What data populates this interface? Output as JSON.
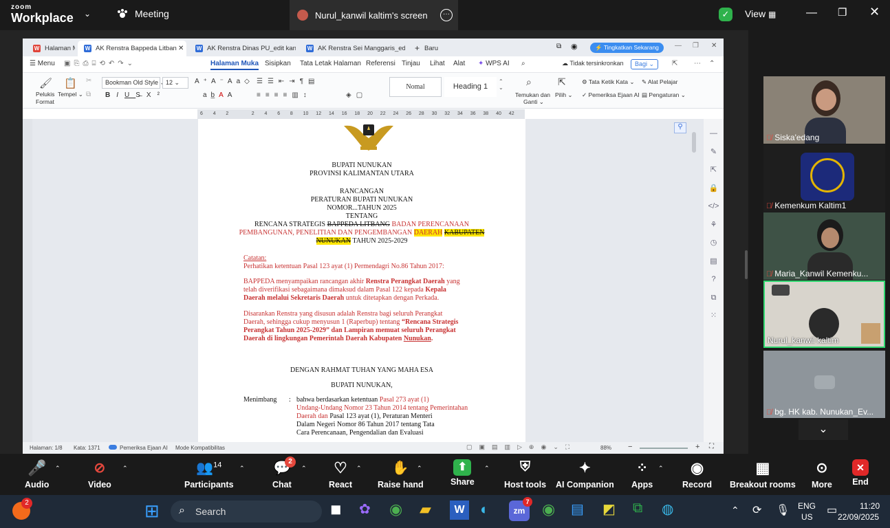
{
  "zoom": {
    "logo_top": "zoom",
    "logo_bottom": "Workplace",
    "meeting_label": "Meeting",
    "share_title": "Nurul_kanwil kaltim's screen",
    "view_label": "View"
  },
  "wps": {
    "tabs": [
      "Halaman Mu",
      "AK Renstra Bappeda Litban",
      "AK Renstra Dinas PU_edit kanwil.doc",
      "AK Renstra Sei Manggaris_edit kanwi",
      "Baru"
    ],
    "upgrade": "Tingkatkan Sekarang",
    "menu": [
      "Menu",
      "Halaman Muka",
      "Sisipkan",
      "Tata Letak Halaman",
      "Referensi",
      "Tinjau",
      "Lihat",
      "Alat",
      "WPS AI"
    ],
    "sync": "Tidak tersinkronkan",
    "share": "Bagi",
    "font": "Bookman Old Style",
    "size": "12",
    "style_normal": "Nomal",
    "style_heading": "Heading 1",
    "ribbon_labels": {
      "pelukis": "Pelukis",
      "format": "Format",
      "tempel": "Tempel",
      "temukan": "Temukan dan",
      "ganti": "Ganti",
      "pilih": "Pilih",
      "tata_ketik": "Tata Ketik Kata",
      "alat_pelajar": "Alat Pelajar",
      "pemeriksa": "Pemeriksa Ejaan AI",
      "pengaturan": "Pengaturan"
    },
    "ruler": [
      "6",
      "4",
      "2",
      "",
      "2",
      "4",
      "6",
      "8",
      "10",
      "12",
      "14",
      "16",
      "18",
      "20",
      "22",
      "24",
      "26",
      "28",
      "30",
      "32",
      "34",
      "36",
      "38",
      "40",
      "42"
    ],
    "status": {
      "page": "Halaman: 1/8",
      "words": "Kata: 1371",
      "spell": "Pemeriksa Ejaan AI",
      "mode": "Mode Kompatibilitas",
      "zoom": "88%"
    }
  },
  "doc": {
    "l1": "BUPATI NUNUKAN",
    "l2": "PROVINSI KALIMANTAN UTARA",
    "l3": "RANCANGAN",
    "l4": "PERATURAN BUPATI NUNUKAN",
    "l5": "NOMOR...TAHUN 2025",
    "l6": "TENTANG",
    "t1a": "RENCANA STRATEGIS ",
    "t1b": "BAPPEDA LITBANG",
    "t1c": " BADAN PERENCANAAN",
    "t2a": "PEMBANGUNAN, PENELITIAN DAN PENGEMBANGAN ",
    "t2b": "DAERAH",
    "t2c": " ",
    "t2d": "KABUPATEN",
    "t3a": "NUNUKAN",
    "t3b": " TAHUN 2025-2029",
    "catatan": "Catatan:",
    "n1": "Perhatikan ketentuan Pasal 123 ayat (1) Permendagri No.86 Tahun 2017:",
    "p1a": "BAPPEDA menyampaikan rancangan akhir ",
    "p1b": "Renstra Perangkat Daerah",
    "p1c": " yang",
    "p2a": "telah diverifikasi sebagaimana dimaksud dalam Pasal 122 kepada ",
    "p2b": "Kepala",
    "p3a": "Daerah melalui Sekretaris Daerah",
    "p3b": " untuk ditetapkan dengan Perkada.",
    "q1": "Disarankan Renstra yang disusun adalah Renstra bagi seluruh Perangkat",
    "q2a": "Daerah, sehingga cukup menyusun 1 (Raperbup) tentang ",
    "q2b": "“Rencana Strategis",
    "q3": "Perangkat Tahun 2025-2029” dan Lampiran memuat seluruh Perangkat",
    "q4a": "Daerah di lingkungan Pemerintah Daerah Kabupaten ",
    "q4b": "Nunukan",
    ".": ".",
    "rahmat": "DENGAN RAHMAT TUHAN YANG MAHA ESA",
    "bupati": "BUPATI NUNUKAN,",
    "menimbang": "Menimbang",
    ":": ":",
    "m1a": "bahwa berdasarkan ketentuan ",
    "m1b": "Pasal 273 ayat (1)",
    "m2": "Undang-Undang Nomor 23 Tahun 2014 tentang Pemerintahan",
    "m3a": "Daerah dan ",
    "m3b": "Pasal 123 ayat (1), Peraturan Menteri",
    "m4": "Dalam Negeri Nomor 86 Tahun 2017 tentang Tata",
    "m5": "Cara Perencanaan, Pengendalian dan Evaluasi"
  },
  "participants": [
    {
      "name": "Siska'edang"
    },
    {
      "name": "Kemenkum Kaltim1"
    },
    {
      "name": "Maria_Kanwil Kemenku..."
    },
    {
      "name": "Nurul_kanwil kaltim"
    },
    {
      "name": "bg. HK kab. Nunukan_Ev..."
    }
  ],
  "controls": {
    "audio": "Audio",
    "video": "Video",
    "participants": "Participants",
    "participants_count": "14",
    "chat": "Chat",
    "chat_badge": "2",
    "react": "React",
    "raise": "Raise hand",
    "share": "Share",
    "host": "Host tools",
    "ai": "AI Companion",
    "apps": "Apps",
    "record": "Record",
    "breakout": "Breakout rooms",
    "more": "More",
    "end": "End"
  },
  "taskbar": {
    "search": "Search",
    "lang1": "ENG",
    "lang2": "US",
    "time": "11:20",
    "date": "22/09/2025",
    "badge": "2",
    "zm_badge": "7"
  }
}
